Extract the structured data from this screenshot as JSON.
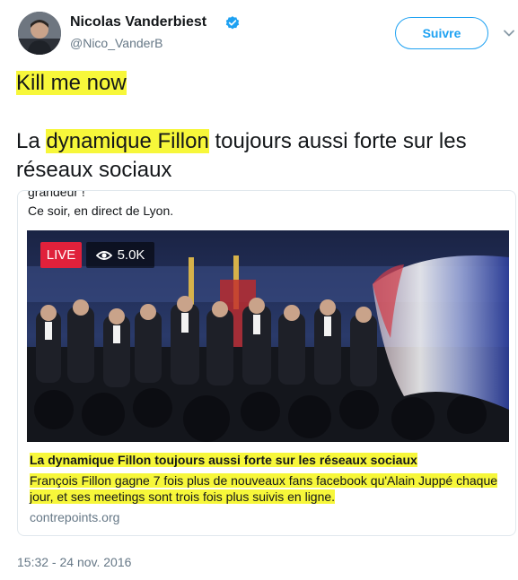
{
  "author": {
    "name": "Nicolas Vanderbiest",
    "handle": "@Nico_VanderB"
  },
  "icons": {
    "verified": "verified-badge-icon",
    "caret": "chevron-down-icon",
    "eye": "eye-icon"
  },
  "follow_label": "Suivre",
  "tweet": {
    "line1": "Kill me now",
    "body_pre": "La ",
    "body_highlight": "dynamique Fillon",
    "body_post": " toujours aussi forte sur les réseaux sociaux"
  },
  "card": {
    "top_cut": "grandeur !",
    "caption": "Ce soir, en direct de Lyon.",
    "live_label": "LIVE",
    "viewers": "5.0K",
    "title": "La dynamique Fillon toujours aussi forte sur les réseaux sociaux",
    "description": "François Fillon gagne 7 fois plus de nouveaux fans facebook qu'Alain Juppé chaque jour, et ses meetings sont trois fois plus suivis en ligne.",
    "domain": "contrepoints.org"
  },
  "timestamp": "15:32 - 24 nov. 2016",
  "colors": {
    "accent": "#1da1f2",
    "highlight": "#f7f73a",
    "live_red": "#e0213b"
  }
}
